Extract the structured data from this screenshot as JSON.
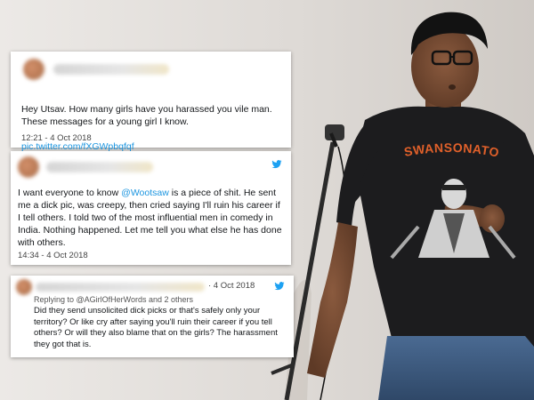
{
  "tweets": [
    {
      "text": "Hey Utsav. How many girls have you harassed you vile man.\nThese messages for a young girl I know.",
      "link": "pic.twitter.com/fXGWpbqfqf",
      "time": "12:21 - 4 Oct 2018"
    },
    {
      "text_before": "I want everyone to know ",
      "mention": "@Wootsaw",
      "text_after": " is a piece of shit. He sent\nme a dick pic, was creepy, then cried saying I'll ruin his career if\nI tell others. I told two of the most influential men in comedy in\nIndia. Nothing happened. Let me tell you what else he has done\nwith others.",
      "time": "14:34 - 4 Oct 2018"
    },
    {
      "date": "· 4 Oct 2018",
      "replying_to": "Replying to @AGirlOfHerWords and 2 others",
      "text": "Did they send unsolicited dick picks or that's safely only your\nterritory? Or like cry after saying you'll ruin their career if you tell\nothers? Or will they also blame that on the girls? The harassment\nthey got that is."
    }
  ],
  "tshirt_text": "SWANSONATOR",
  "colors": {
    "link": "#1b95e0",
    "tshirt": "#1c1c1e",
    "jeans": "#3d5a80"
  },
  "icons": [
    "twitter-bird-icon",
    "microphone-icon"
  ]
}
